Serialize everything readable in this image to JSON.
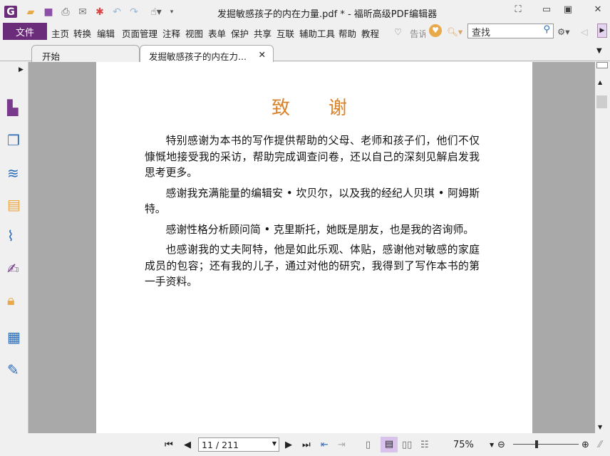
{
  "window": {
    "title": "发掘敏感孩子的内在力量.pdf * - 福昕高级PDF编辑器"
  },
  "menu": {
    "file": "文件",
    "items": [
      "主页",
      "转换",
      "编辑",
      "页面管理",
      "注释",
      "视图",
      "表单",
      "保护",
      "共享",
      "互联",
      "辅助工具",
      "帮助",
      "教程"
    ],
    "tell_me": "告诉",
    "search_placeholder": "查找"
  },
  "tabs": [
    {
      "label": "开始"
    },
    {
      "label": "发掘敏感孩子的内在力...",
      "active": true
    }
  ],
  "document": {
    "heading": "致　谢",
    "paragraphs": [
      "特别感谢为本书的写作提供帮助的父母、老师和孩子们，他们不仅慷慨地接受我的采访，帮助完成调查问卷，还以自己的深刻见解启发我思考更多。",
      "感谢我充满能量的编辑安 • 坎贝尔，以及我的经纪人贝琪 • 阿姆斯特。",
      "感谢性格分析顾问简 • 克里斯托，她既是朋友，也是我的咨询师。",
      "也感谢我的丈夫阿特，他是如此乐观、体贴，感谢他对敏感的家庭成员的包容；还有我的儿子，通过对他的研究，我得到了写作本书的第一手资料。"
    ]
  },
  "status": {
    "page": "11 / 211",
    "zoom": "75%",
    "zoom_level_percent": 75
  },
  "colors": {
    "brand": "#6b2c7a",
    "heading": "#d9822b"
  }
}
